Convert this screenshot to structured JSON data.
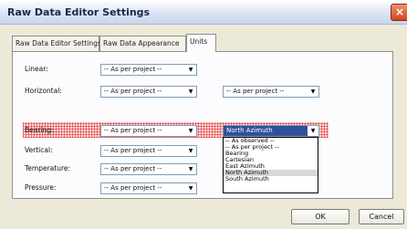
{
  "window": {
    "title": "Raw Data Editor Settings"
  },
  "tabs": [
    {
      "label": "Raw Data Editor Settings",
      "active": false
    },
    {
      "label": "Raw Data Appearance",
      "active": false
    },
    {
      "label": "Units",
      "active": true
    }
  ],
  "rows": [
    {
      "label": "Linear:",
      "value": "-- As per project --"
    },
    {
      "label": "Horizontal:",
      "value": "-- As per project --",
      "secondary_value": "-- As per project --"
    },
    {
      "label": "Bearing:",
      "value": "-- As per project --",
      "secondary_value": "North Azimuth"
    },
    {
      "label": "Vertical:",
      "value": "-- As per project --"
    },
    {
      "label": "Temperature:",
      "value": "-- As per project --"
    },
    {
      "label": "Pressure:",
      "value": "-- As per project --"
    }
  ],
  "dropdown": {
    "options": [
      "-- As observed --",
      "-- As per project --",
      "Bearing",
      "Cartesian",
      "East Azimuth",
      "North Azimuth",
      "South Azimuth"
    ],
    "highlighted": "North Azimuth"
  },
  "buttons": {
    "ok": "OK",
    "cancel": "Cancel"
  },
  "icons": {
    "close": "close-icon",
    "dropdown_arrow": "chevron-down-icon"
  },
  "colors": {
    "selection": "#31509c",
    "highlight_hatch": "#dc2828"
  }
}
